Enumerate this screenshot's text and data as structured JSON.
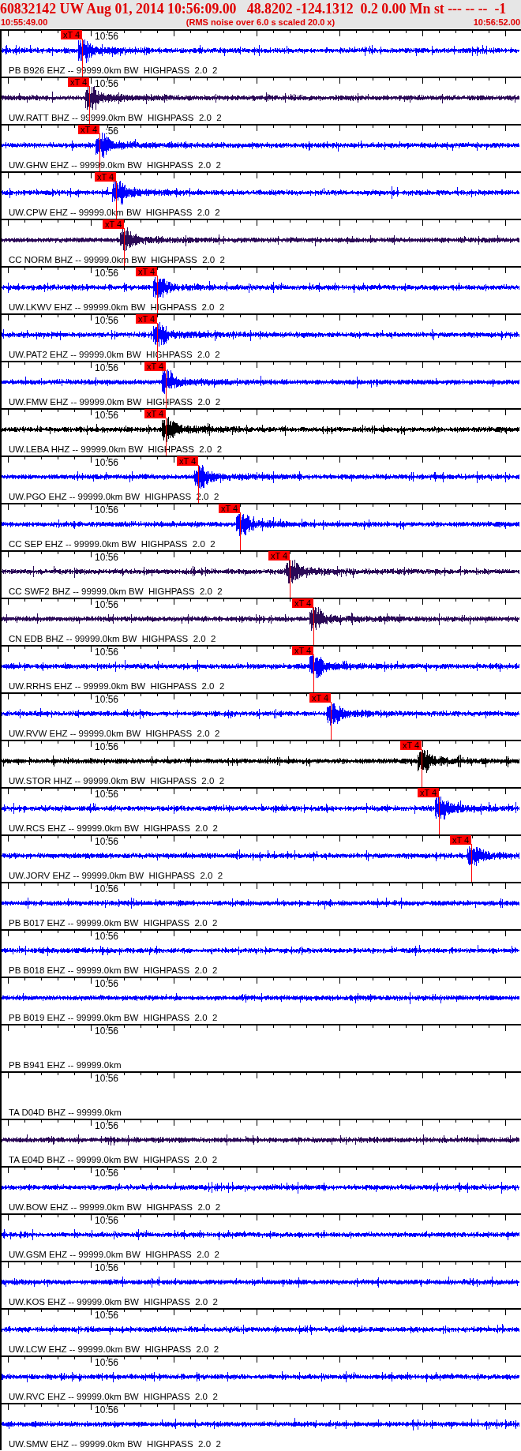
{
  "header": {
    "title": "60832142 UW Aug 01, 2014 10:56:09.00   48.8202 -124.1312  0.2 0.00 Mn st --- -- --  -1",
    "start_time": "10:55:49.00",
    "note": "(RMS noise over 6.0 s scaled 20.0 x)",
    "end_time": "10:56:52.00"
  },
  "traces": [
    {
      "kind": "waveform",
      "label": "PB B926 EHZ -- 99999.0km BW  HIGHPASS  2.0  2",
      "time_label": "10:56",
      "color": "#0000ff",
      "pick": "xT 4"
    },
    {
      "kind": "waveform",
      "label": "UW.RATT BHZ -- 99999.0km BW  HIGHPASS  2.0  2",
      "time_label": "10:56",
      "color": "#2b0a57",
      "pick": "xT 4"
    },
    {
      "kind": "waveform",
      "label": "UW.GHW EHZ -- 99999.0km BW  HIGHPASS  2.0  2",
      "time_label": ":56",
      "color": "#0000ff",
      "pick": "xT 4"
    },
    {
      "kind": "waveform",
      "label": "UW.CPW EHZ -- 99999.0km BW  HIGHPASS  2.0  2",
      "color": "#0000ff",
      "pick": "xT 4"
    },
    {
      "kind": "waveform",
      "label": "CC NORM BHZ -- 99999.0km BW  HIGHPASS  2.0  2",
      "color": "#2b0a57",
      "pick": "xT 4"
    },
    {
      "kind": "waveform",
      "label": "UW.LKWV EHZ -- 99999.0km BW  HIGHPASS  2.0  2",
      "time_label": "10:56",
      "color": "#0000ff",
      "pick": "xT 4"
    },
    {
      "kind": "waveform",
      "label": "UW.PAT2 EHZ -- 99999.0km BW  HIGHPASS  2.0  2",
      "time_label": "10:56",
      "color": "#0000ff",
      "pick": "xT 4"
    },
    {
      "kind": "waveform",
      "label": "UW.FMW EHZ -- 99999.0km BW  HIGHPASS  2.0  2",
      "time_label": "10:56",
      "color": "#0000ff",
      "pick": "xT 4"
    },
    {
      "kind": "waveform",
      "label": "UW.LEBA HHZ -- 99999.0km BW  HIGHPASS  2.0  2",
      "time_label": "10:56",
      "color": "#000000",
      "pick": "xT 4"
    },
    {
      "kind": "waveform",
      "label": "UW.PGO EHZ -- 99999.0km BW  HIGHPASS  2.0  2",
      "time_label": "10:56",
      "color": "#0000ff",
      "pick": "xT 4"
    },
    {
      "kind": "waveform",
      "label": "CC SEP EHZ -- 99999.0km BW  HIGHPASS  2.0  2",
      "time_label": "10:56",
      "color": "#0000ff",
      "pick": "xT 4"
    },
    {
      "kind": "waveform",
      "label": "CC SWF2 BHZ -- 99999.0km BW  HIGHPASS  2.0  2",
      "time_label": "10:56",
      "color": "#2b0a57",
      "pick": "xT 4"
    },
    {
      "kind": "waveform",
      "label": "CN EDB BHZ -- 99999.0km BW  HIGHPASS  2.0  2",
      "time_label": "10:56",
      "color": "#2b0a57",
      "pick": "xT 4"
    },
    {
      "kind": "waveform",
      "label": "UW.RRHS EHZ -- 99999.0km BW  HIGHPASS  2.0  2",
      "time_label": "10:56",
      "color": "#0000ff",
      "pick": "xT 4"
    },
    {
      "kind": "waveform",
      "label": "UW.RVW EHZ -- 99999.0km BW  HIGHPASS  2.0  2",
      "time_label": "10:56",
      "color": "#0000ff",
      "pick": "xT 4"
    },
    {
      "kind": "waveform",
      "label": "UW.STOR HHZ -- 99999.0km BW  HIGHPASS  2.0  2",
      "time_label": "10:56",
      "color": "#000000",
      "pick": "xT 4"
    },
    {
      "kind": "waveform",
      "label": "UW.RCS EHZ -- 99999.0km BW  HIGHPASS  2.0  2",
      "time_label": "10:56",
      "color": "#0000ff",
      "pick": "xT 4"
    },
    {
      "kind": "waveform",
      "label": "UW.JORV EHZ -- 99999.0km BW  HIGHPASS  2.0  2",
      "time_label": "10:56",
      "color": "#0000ff",
      "pick": "xT 4"
    },
    {
      "kind": "waveform",
      "label": "PB B017 EHZ -- 99999.0km BW  HIGHPASS  2.0  2",
      "time_label": "10:56",
      "color": "#0000ff"
    },
    {
      "kind": "waveform",
      "label": "PB B018 EHZ -- 99999.0km BW  HIGHPASS  2.0  2",
      "time_label": "10:56",
      "color": "#0000ff"
    },
    {
      "kind": "waveform",
      "label": "PB B019 EHZ -- 99999.0km BW  HIGHPASS  2.0  2",
      "time_label": "10:56",
      "color": "#0000ff"
    },
    {
      "kind": "empty",
      "label": "PB B941 EHZ -- 99999.0km",
      "time_label": "10:56"
    },
    {
      "kind": "empty",
      "label": "TA D04D BHZ -- 99999.0km",
      "time_label": "10:56"
    },
    {
      "kind": "waveform",
      "label": "TA E04D BHZ -- 99999.0km BW  HIGHPASS  2.0  2",
      "time_label": "10:56",
      "color": "#2b0a57"
    },
    {
      "kind": "waveform",
      "label": "UW.BOW EHZ -- 99999.0km BW  HIGHPASS  2.0  2",
      "time_label": "10:56",
      "color": "#0000ff"
    },
    {
      "kind": "waveform",
      "label": "UW.GSM EHZ -- 99999.0km BW  HIGHPASS  2.0  2",
      "time_label": "10:56",
      "color": "#0000ff"
    },
    {
      "kind": "waveform",
      "label": "UW.KOS EHZ -- 99999.0km BW  HIGHPASS  2.0  2",
      "time_label": "10:56",
      "color": "#0000ff"
    },
    {
      "kind": "waveform",
      "label": "UW.LCW EHZ -- 99999.0km BW  HIGHPASS  2.0  2",
      "time_label": "10:56",
      "color": "#0000ff"
    },
    {
      "kind": "waveform",
      "label": "UW.RVC EHZ -- 99999.0km BW  HIGHPASS  2.0  2",
      "time_label": "10:56",
      "color": "#0000ff"
    },
    {
      "kind": "waveform",
      "label": "UW.SMW EHZ -- 99999.0km BW  HIGHPASS  2.0  2",
      "time_label": "10:56",
      "color": "#0000ff"
    }
  ]
}
